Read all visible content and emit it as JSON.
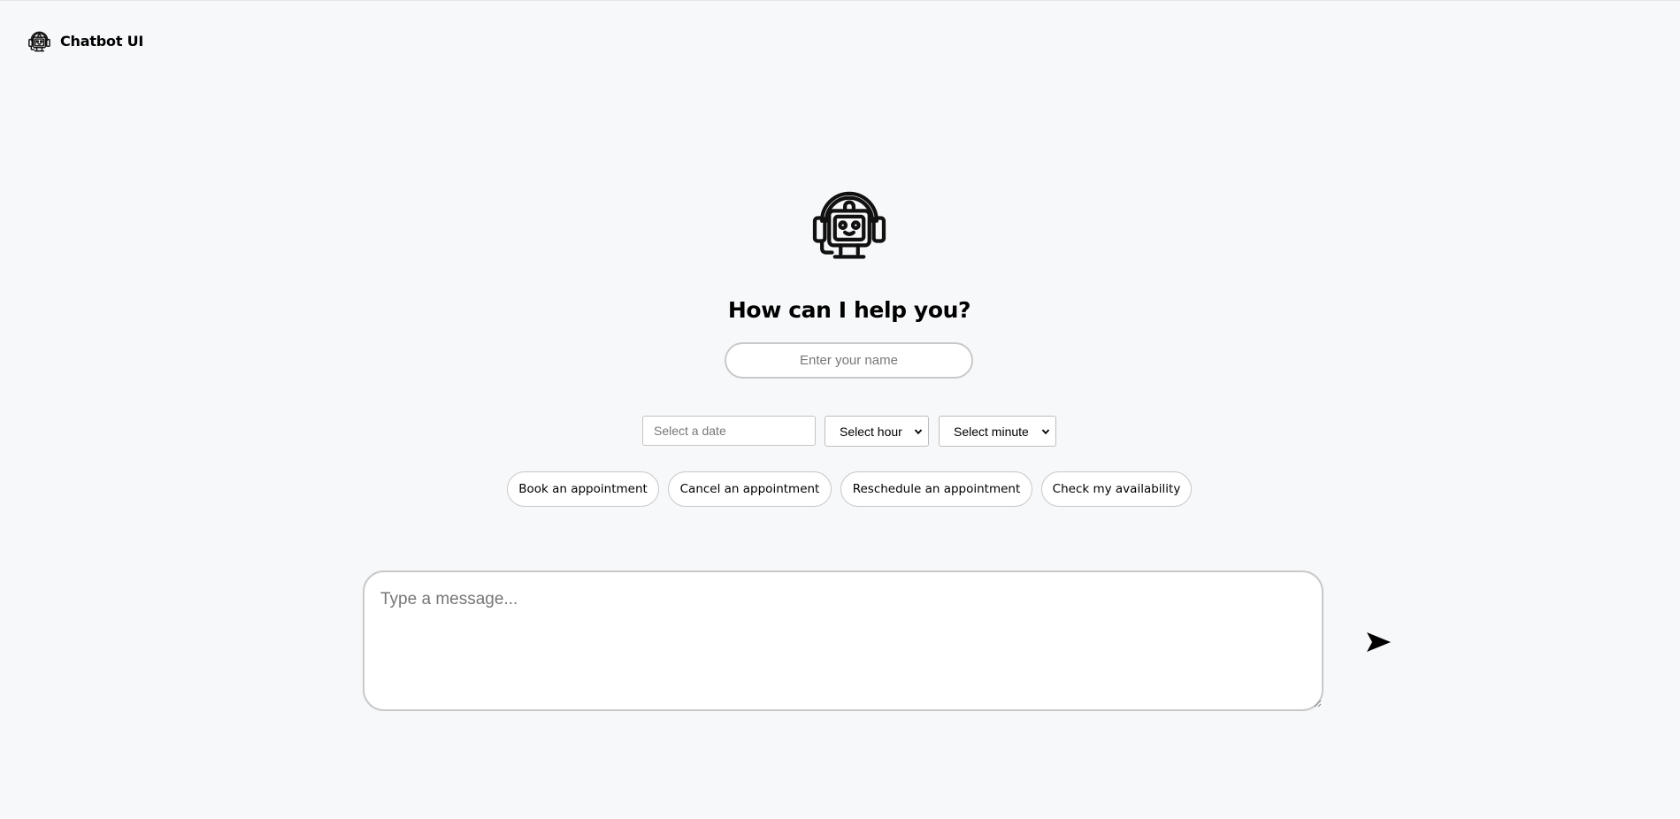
{
  "header": {
    "app_title": "Chatbot UI",
    "logo_icon": "robot-headset-icon"
  },
  "hero": {
    "icon": "robot-headset-icon",
    "headline": "How can I help you?"
  },
  "form": {
    "name_placeholder": "Enter your name",
    "name_value": "",
    "date_placeholder": "Select a date",
    "hour_select": "Select hour",
    "minute_select": "Select minute"
  },
  "actions": [
    {
      "label": "Book an appointment"
    },
    {
      "label": "Cancel an appointment"
    },
    {
      "label": "Reschedule an appointment"
    },
    {
      "label": "Check my availability"
    }
  ],
  "composer": {
    "placeholder": "Type a message...",
    "value": "",
    "send_icon": "send-arrow-icon"
  },
  "colors": {
    "background": "#f7f8fa",
    "border": "#c9c9c9",
    "text": "#000000"
  }
}
